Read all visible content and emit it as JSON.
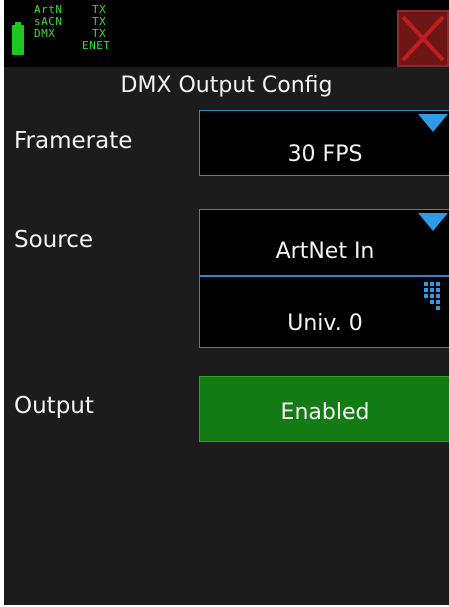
{
  "status": {
    "protocols": [
      {
        "name": "ArtN",
        "state": "TX"
      },
      {
        "name": "sACN",
        "state": "TX"
      },
      {
        "name": "DMX",
        "state": "TX"
      }
    ],
    "network": "ENET"
  },
  "screen": {
    "title": "DMX Output Config"
  },
  "framerate": {
    "label": "Framerate",
    "value": "30 FPS"
  },
  "source": {
    "label": "Source",
    "value": "ArtNet In",
    "universe": "Univ. 0"
  },
  "output": {
    "label": "Output",
    "value": "Enabled"
  },
  "colors": {
    "accent_blue": "#2f86c8",
    "status_green": "#2ee02e",
    "enabled_green": "#137b13",
    "close_red": "#6e1616"
  },
  "icons": {
    "battery": "battery-icon",
    "close": "close-x-icon",
    "dropdown": "triangle-down-icon",
    "keypad": "keypad-grid-icon"
  }
}
